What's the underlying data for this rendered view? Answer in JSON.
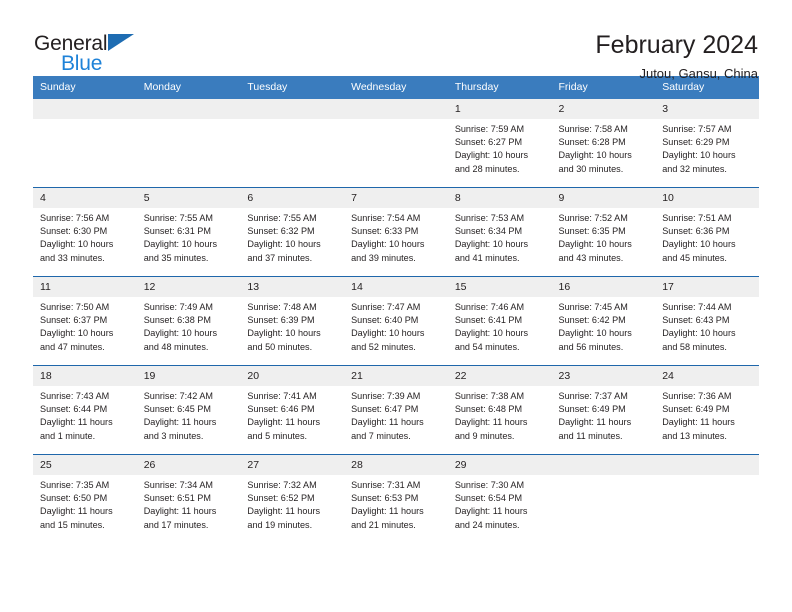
{
  "brand": {
    "name_part1": "General",
    "name_part2": "Blue",
    "triangle_icon": "triangle-icon",
    "accent_blue": "#1e82d8",
    "logo_blue": "#1e6cb2"
  },
  "header": {
    "title": "February 2024",
    "subtitle": "Jutou, Gansu, China"
  },
  "calendar": {
    "header_bg": "#3a7cbe",
    "row_divider": "#1f67ab",
    "daynum_bg": "#efefef",
    "weekday_headers": [
      "Sunday",
      "Monday",
      "Tuesday",
      "Wednesday",
      "Thursday",
      "Friday",
      "Saturday"
    ],
    "weeks": [
      [
        {
          "day": "",
          "empty": true,
          "lines": []
        },
        {
          "day": "",
          "empty": true,
          "lines": []
        },
        {
          "day": "",
          "empty": true,
          "lines": []
        },
        {
          "day": "",
          "empty": true,
          "lines": []
        },
        {
          "day": "1",
          "empty": false,
          "lines": [
            "Sunrise: 7:59 AM",
            "Sunset: 6:27 PM",
            "Daylight: 10 hours",
            "and 28 minutes."
          ]
        },
        {
          "day": "2",
          "empty": false,
          "lines": [
            "Sunrise: 7:58 AM",
            "Sunset: 6:28 PM",
            "Daylight: 10 hours",
            "and 30 minutes."
          ]
        },
        {
          "day": "3",
          "empty": false,
          "lines": [
            "Sunrise: 7:57 AM",
            "Sunset: 6:29 PM",
            "Daylight: 10 hours",
            "and 32 minutes."
          ]
        }
      ],
      [
        {
          "day": "4",
          "empty": false,
          "lines": [
            "Sunrise: 7:56 AM",
            "Sunset: 6:30 PM",
            "Daylight: 10 hours",
            "and 33 minutes."
          ]
        },
        {
          "day": "5",
          "empty": false,
          "lines": [
            "Sunrise: 7:55 AM",
            "Sunset: 6:31 PM",
            "Daylight: 10 hours",
            "and 35 minutes."
          ]
        },
        {
          "day": "6",
          "empty": false,
          "lines": [
            "Sunrise: 7:55 AM",
            "Sunset: 6:32 PM",
            "Daylight: 10 hours",
            "and 37 minutes."
          ]
        },
        {
          "day": "7",
          "empty": false,
          "lines": [
            "Sunrise: 7:54 AM",
            "Sunset: 6:33 PM",
            "Daylight: 10 hours",
            "and 39 minutes."
          ]
        },
        {
          "day": "8",
          "empty": false,
          "lines": [
            "Sunrise: 7:53 AM",
            "Sunset: 6:34 PM",
            "Daylight: 10 hours",
            "and 41 minutes."
          ]
        },
        {
          "day": "9",
          "empty": false,
          "lines": [
            "Sunrise: 7:52 AM",
            "Sunset: 6:35 PM",
            "Daylight: 10 hours",
            "and 43 minutes."
          ]
        },
        {
          "day": "10",
          "empty": false,
          "lines": [
            "Sunrise: 7:51 AM",
            "Sunset: 6:36 PM",
            "Daylight: 10 hours",
            "and 45 minutes."
          ]
        }
      ],
      [
        {
          "day": "11",
          "empty": false,
          "lines": [
            "Sunrise: 7:50 AM",
            "Sunset: 6:37 PM",
            "Daylight: 10 hours",
            "and 47 minutes."
          ]
        },
        {
          "day": "12",
          "empty": false,
          "lines": [
            "Sunrise: 7:49 AM",
            "Sunset: 6:38 PM",
            "Daylight: 10 hours",
            "and 48 minutes."
          ]
        },
        {
          "day": "13",
          "empty": false,
          "lines": [
            "Sunrise: 7:48 AM",
            "Sunset: 6:39 PM",
            "Daylight: 10 hours",
            "and 50 minutes."
          ]
        },
        {
          "day": "14",
          "empty": false,
          "lines": [
            "Sunrise: 7:47 AM",
            "Sunset: 6:40 PM",
            "Daylight: 10 hours",
            "and 52 minutes."
          ]
        },
        {
          "day": "15",
          "empty": false,
          "lines": [
            "Sunrise: 7:46 AM",
            "Sunset: 6:41 PM",
            "Daylight: 10 hours",
            "and 54 minutes."
          ]
        },
        {
          "day": "16",
          "empty": false,
          "lines": [
            "Sunrise: 7:45 AM",
            "Sunset: 6:42 PM",
            "Daylight: 10 hours",
            "and 56 minutes."
          ]
        },
        {
          "day": "17",
          "empty": false,
          "lines": [
            "Sunrise: 7:44 AM",
            "Sunset: 6:43 PM",
            "Daylight: 10 hours",
            "and 58 minutes."
          ]
        }
      ],
      [
        {
          "day": "18",
          "empty": false,
          "lines": [
            "Sunrise: 7:43 AM",
            "Sunset: 6:44 PM",
            "Daylight: 11 hours",
            "and 1 minute."
          ]
        },
        {
          "day": "19",
          "empty": false,
          "lines": [
            "Sunrise: 7:42 AM",
            "Sunset: 6:45 PM",
            "Daylight: 11 hours",
            "and 3 minutes."
          ]
        },
        {
          "day": "20",
          "empty": false,
          "lines": [
            "Sunrise: 7:41 AM",
            "Sunset: 6:46 PM",
            "Daylight: 11 hours",
            "and 5 minutes."
          ]
        },
        {
          "day": "21",
          "empty": false,
          "lines": [
            "Sunrise: 7:39 AM",
            "Sunset: 6:47 PM",
            "Daylight: 11 hours",
            "and 7 minutes."
          ]
        },
        {
          "day": "22",
          "empty": false,
          "lines": [
            "Sunrise: 7:38 AM",
            "Sunset: 6:48 PM",
            "Daylight: 11 hours",
            "and 9 minutes."
          ]
        },
        {
          "day": "23",
          "empty": false,
          "lines": [
            "Sunrise: 7:37 AM",
            "Sunset: 6:49 PM",
            "Daylight: 11 hours",
            "and 11 minutes."
          ]
        },
        {
          "day": "24",
          "empty": false,
          "lines": [
            "Sunrise: 7:36 AM",
            "Sunset: 6:49 PM",
            "Daylight: 11 hours",
            "and 13 minutes."
          ]
        }
      ],
      [
        {
          "day": "25",
          "empty": false,
          "lines": [
            "Sunrise: 7:35 AM",
            "Sunset: 6:50 PM",
            "Daylight: 11 hours",
            "and 15 minutes."
          ]
        },
        {
          "day": "26",
          "empty": false,
          "lines": [
            "Sunrise: 7:34 AM",
            "Sunset: 6:51 PM",
            "Daylight: 11 hours",
            "and 17 minutes."
          ]
        },
        {
          "day": "27",
          "empty": false,
          "lines": [
            "Sunrise: 7:32 AM",
            "Sunset: 6:52 PM",
            "Daylight: 11 hours",
            "and 19 minutes."
          ]
        },
        {
          "day": "28",
          "empty": false,
          "lines": [
            "Sunrise: 7:31 AM",
            "Sunset: 6:53 PM",
            "Daylight: 11 hours",
            "and 21 minutes."
          ]
        },
        {
          "day": "29",
          "empty": false,
          "lines": [
            "Sunrise: 7:30 AM",
            "Sunset: 6:54 PM",
            "Daylight: 11 hours",
            "and 24 minutes."
          ]
        },
        {
          "day": "",
          "empty": true,
          "lines": []
        },
        {
          "day": "",
          "empty": true,
          "lines": []
        }
      ]
    ]
  }
}
